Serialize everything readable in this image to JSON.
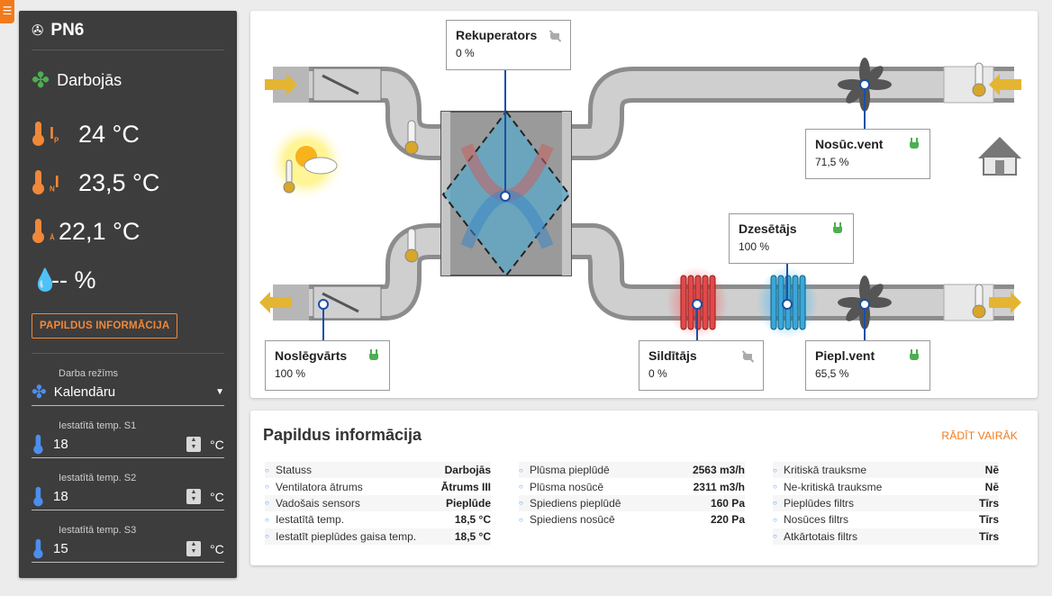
{
  "device": {
    "name": "PN6",
    "status": "Darbojās"
  },
  "sidebar": {
    "temps": [
      {
        "sub": "I",
        "sub_index": "P",
        "value": "24 °C"
      },
      {
        "sub": "I",
        "sub_index": "N",
        "value": "23,5 °C"
      },
      {
        "sub": "",
        "sub_index": "Ā",
        "value": "22,1 °C"
      }
    ],
    "humidity": "-- %",
    "info_button": "PAPILDUS INFORMĀCIJA",
    "mode_label": "Darba režīms",
    "mode_value": "Kalendāru",
    "setpoints": [
      {
        "label": "Iestatītā temp. S1",
        "value": "18",
        "unit": "°C"
      },
      {
        "label": "Iestatītā temp. S2",
        "value": "18",
        "unit": "°C"
      },
      {
        "label": "Iestatītā temp. S3",
        "value": "15",
        "unit": "°C"
      }
    ]
  },
  "diagram": {
    "recuperator": {
      "name": "Rekuperators",
      "value": "0 %",
      "power": "off"
    },
    "exhaust_fan": {
      "name": "Nosūc.vent",
      "value": "71,5 %",
      "power": "on"
    },
    "cooler": {
      "name": "Dzesētājs",
      "value": "100 %",
      "power": "on"
    },
    "damper": {
      "name": "Noslēgvārts",
      "value": "100 %",
      "power": "on"
    },
    "heater": {
      "name": "Sildītājs",
      "value": "0 %",
      "power": "off"
    },
    "supply_fan": {
      "name": "Piepl.vent",
      "value": "65,5 %",
      "power": "on"
    }
  },
  "info": {
    "title": "Papildus informācija",
    "more": "RĀDĪT VAIRĀK",
    "col1": [
      {
        "k": "Statuss",
        "v": "Darbojās"
      },
      {
        "k": "Ventilatora ātrums",
        "v": "Ātrums III"
      },
      {
        "k": "Vadošais sensors",
        "v": "Pieplūde"
      },
      {
        "k": "Iestatītā temp.",
        "v": "18,5 °C"
      },
      {
        "k": "Iestatīt pieplūdes gaisa temp.",
        "v": "18,5 °C"
      }
    ],
    "col2": [
      {
        "k": "Plūsma pieplūdē",
        "v": "2563 m3/h"
      },
      {
        "k": "Plūsma nosūcē",
        "v": "2311 m3/h"
      },
      {
        "k": "Spiediens pieplūdē",
        "v": "160 Pa"
      },
      {
        "k": "Spiediens nosūcē",
        "v": "220 Pa"
      }
    ],
    "col3": [
      {
        "k": "Kritiskā trauksme",
        "v": "Nē"
      },
      {
        "k": "Ne-kritiskā trauksme",
        "v": "Nē"
      },
      {
        "k": "Pieplūdes filtrs",
        "v": "Tīrs"
      },
      {
        "k": "Nosūces filtrs",
        "v": "Tīrs"
      },
      {
        "k": "Atkārtotais filtrs",
        "v": "Tīrs"
      }
    ]
  },
  "colors": {
    "accent": "#f27a1a",
    "on": "#4caf50",
    "off": "#aaaaaa",
    "sidebar": "#3d3d3d"
  }
}
